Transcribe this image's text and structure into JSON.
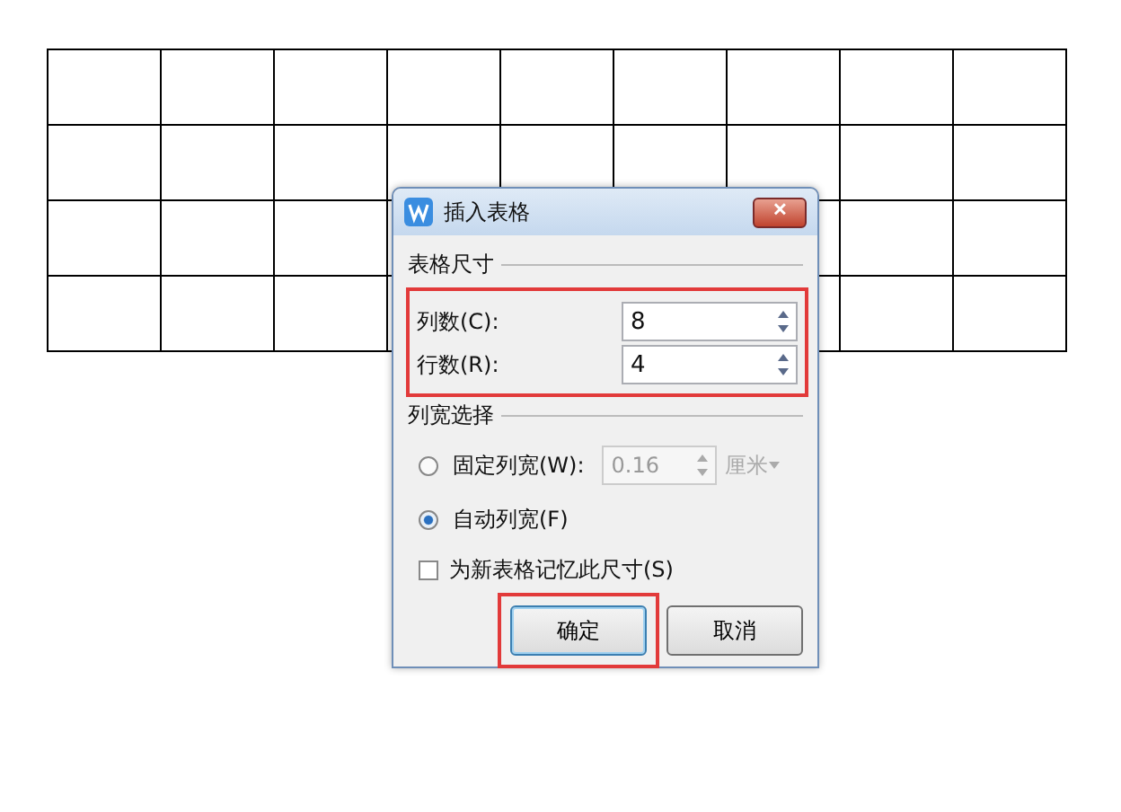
{
  "dialog": {
    "title": "插入表格",
    "close": "✕",
    "size_group": {
      "title": "表格尺寸",
      "fields": [
        {
          "label": "列数(C):",
          "value": "8"
        },
        {
          "label": "行数(R):",
          "value": "4"
        }
      ]
    },
    "width_group": {
      "title": "列宽选择",
      "options": [
        {
          "label": "固定列宽(W):",
          "selected": false,
          "value": "0.16",
          "unit": "厘米"
        },
        {
          "label": "自动列宽(F)",
          "selected": true
        }
      ]
    },
    "remember": {
      "label": "为新表格记忆此尺寸(S)",
      "checked": false
    },
    "buttons": [
      {
        "label": "确定",
        "default": true
      },
      {
        "label": "取消",
        "default": false
      }
    ]
  }
}
